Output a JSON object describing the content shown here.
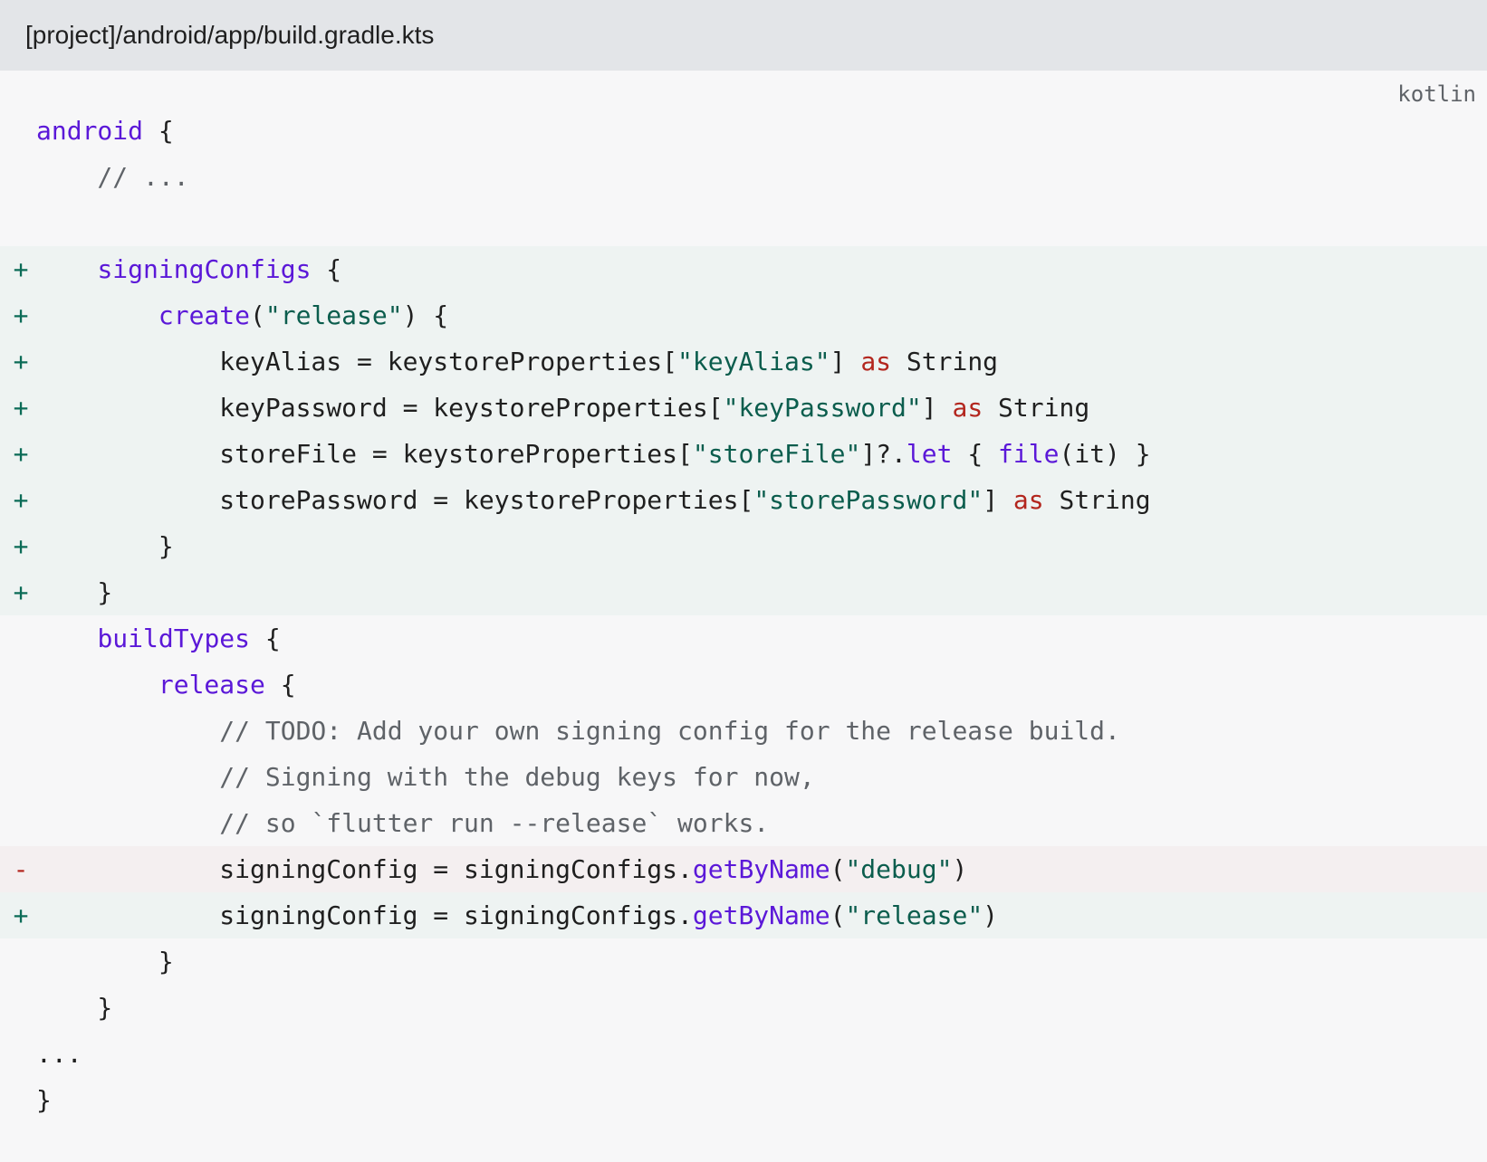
{
  "header": {
    "file_path": "[project]/android/app/build.gradle.kts"
  },
  "code_block": {
    "language": "kotlin",
    "lines": [
      {
        "diff": "",
        "segments": [
          {
            "t": "kw",
            "v": "android"
          },
          {
            "t": "pl",
            "v": " {"
          }
        ]
      },
      {
        "diff": "",
        "segments": [
          {
            "t": "cm",
            "v": "    // ..."
          }
        ]
      },
      {
        "diff": "",
        "segments": [
          {
            "t": "pl",
            "v": ""
          }
        ]
      },
      {
        "diff": "+",
        "segments": [
          {
            "t": "pl",
            "v": "    "
          },
          {
            "t": "kw",
            "v": "signingConfigs"
          },
          {
            "t": "pl",
            "v": " {"
          }
        ]
      },
      {
        "diff": "+",
        "segments": [
          {
            "t": "pl",
            "v": "        "
          },
          {
            "t": "kw",
            "v": "create"
          },
          {
            "t": "pl",
            "v": "("
          },
          {
            "t": "str",
            "v": "\"release\""
          },
          {
            "t": "pl",
            "v": ") {"
          }
        ]
      },
      {
        "diff": "+",
        "segments": [
          {
            "t": "pl",
            "v": "            keyAlias = keystoreProperties["
          },
          {
            "t": "str",
            "v": "\"keyAlias\""
          },
          {
            "t": "pl",
            "v": "] "
          },
          {
            "t": "op",
            "v": "as"
          },
          {
            "t": "pl",
            "v": " String"
          }
        ]
      },
      {
        "diff": "+",
        "segments": [
          {
            "t": "pl",
            "v": "            keyPassword = keystoreProperties["
          },
          {
            "t": "str",
            "v": "\"keyPassword\""
          },
          {
            "t": "pl",
            "v": "] "
          },
          {
            "t": "op",
            "v": "as"
          },
          {
            "t": "pl",
            "v": " String"
          }
        ]
      },
      {
        "diff": "+",
        "segments": [
          {
            "t": "pl",
            "v": "            storeFile = keystoreProperties["
          },
          {
            "t": "str",
            "v": "\"storeFile\""
          },
          {
            "t": "pl",
            "v": "]?."
          },
          {
            "t": "kw",
            "v": "let"
          },
          {
            "t": "pl",
            "v": " { "
          },
          {
            "t": "kw",
            "v": "file"
          },
          {
            "t": "pl",
            "v": "(it) }"
          }
        ]
      },
      {
        "diff": "+",
        "segments": [
          {
            "t": "pl",
            "v": "            storePassword = keystoreProperties["
          },
          {
            "t": "str",
            "v": "\"storePassword\""
          },
          {
            "t": "pl",
            "v": "] "
          },
          {
            "t": "op",
            "v": "as"
          },
          {
            "t": "pl",
            "v": " String"
          }
        ]
      },
      {
        "diff": "+",
        "segments": [
          {
            "t": "pl",
            "v": "        }"
          }
        ]
      },
      {
        "diff": "+",
        "segments": [
          {
            "t": "pl",
            "v": "    }"
          }
        ]
      },
      {
        "diff": "",
        "segments": [
          {
            "t": "pl",
            "v": "    "
          },
          {
            "t": "kw",
            "v": "buildTypes"
          },
          {
            "t": "pl",
            "v": " {"
          }
        ]
      },
      {
        "diff": "",
        "segments": [
          {
            "t": "pl",
            "v": "        "
          },
          {
            "t": "kw",
            "v": "release"
          },
          {
            "t": "pl",
            "v": " {"
          }
        ]
      },
      {
        "diff": "",
        "segments": [
          {
            "t": "cm",
            "v": "            // TODO: Add your own signing config for the release build."
          }
        ]
      },
      {
        "diff": "",
        "segments": [
          {
            "t": "cm",
            "v": "            // Signing with the debug keys for now,"
          }
        ]
      },
      {
        "diff": "",
        "segments": [
          {
            "t": "cm",
            "v": "            // so `flutter run --release` works."
          }
        ]
      },
      {
        "diff": "-",
        "segments": [
          {
            "t": "pl",
            "v": "            signingConfig = signingConfigs."
          },
          {
            "t": "kw",
            "v": "getByName"
          },
          {
            "t": "pl",
            "v": "("
          },
          {
            "t": "str",
            "v": "\"debug\""
          },
          {
            "t": "pl",
            "v": ")"
          }
        ]
      },
      {
        "diff": "+",
        "segments": [
          {
            "t": "pl",
            "v": "            signingConfig = signingConfigs."
          },
          {
            "t": "kw",
            "v": "getByName"
          },
          {
            "t": "pl",
            "v": "("
          },
          {
            "t": "str",
            "v": "\"release\""
          },
          {
            "t": "pl",
            "v": ")"
          }
        ]
      },
      {
        "diff": "",
        "segments": [
          {
            "t": "pl",
            "v": "        }"
          }
        ]
      },
      {
        "diff": "",
        "segments": [
          {
            "t": "pl",
            "v": "    }"
          }
        ]
      },
      {
        "diff": "",
        "segments": [
          {
            "t": "pl",
            "v": "..."
          }
        ]
      },
      {
        "diff": "",
        "segments": [
          {
            "t": "pl",
            "v": "}"
          }
        ]
      }
    ]
  },
  "colors": {
    "keyword": "#5b18d8",
    "string": "#0b5d4d",
    "operator_keyword": "#b3261e",
    "comment": "#5f6368",
    "added_background": "#eef3f2",
    "removed_background": "#f4eff0"
  }
}
